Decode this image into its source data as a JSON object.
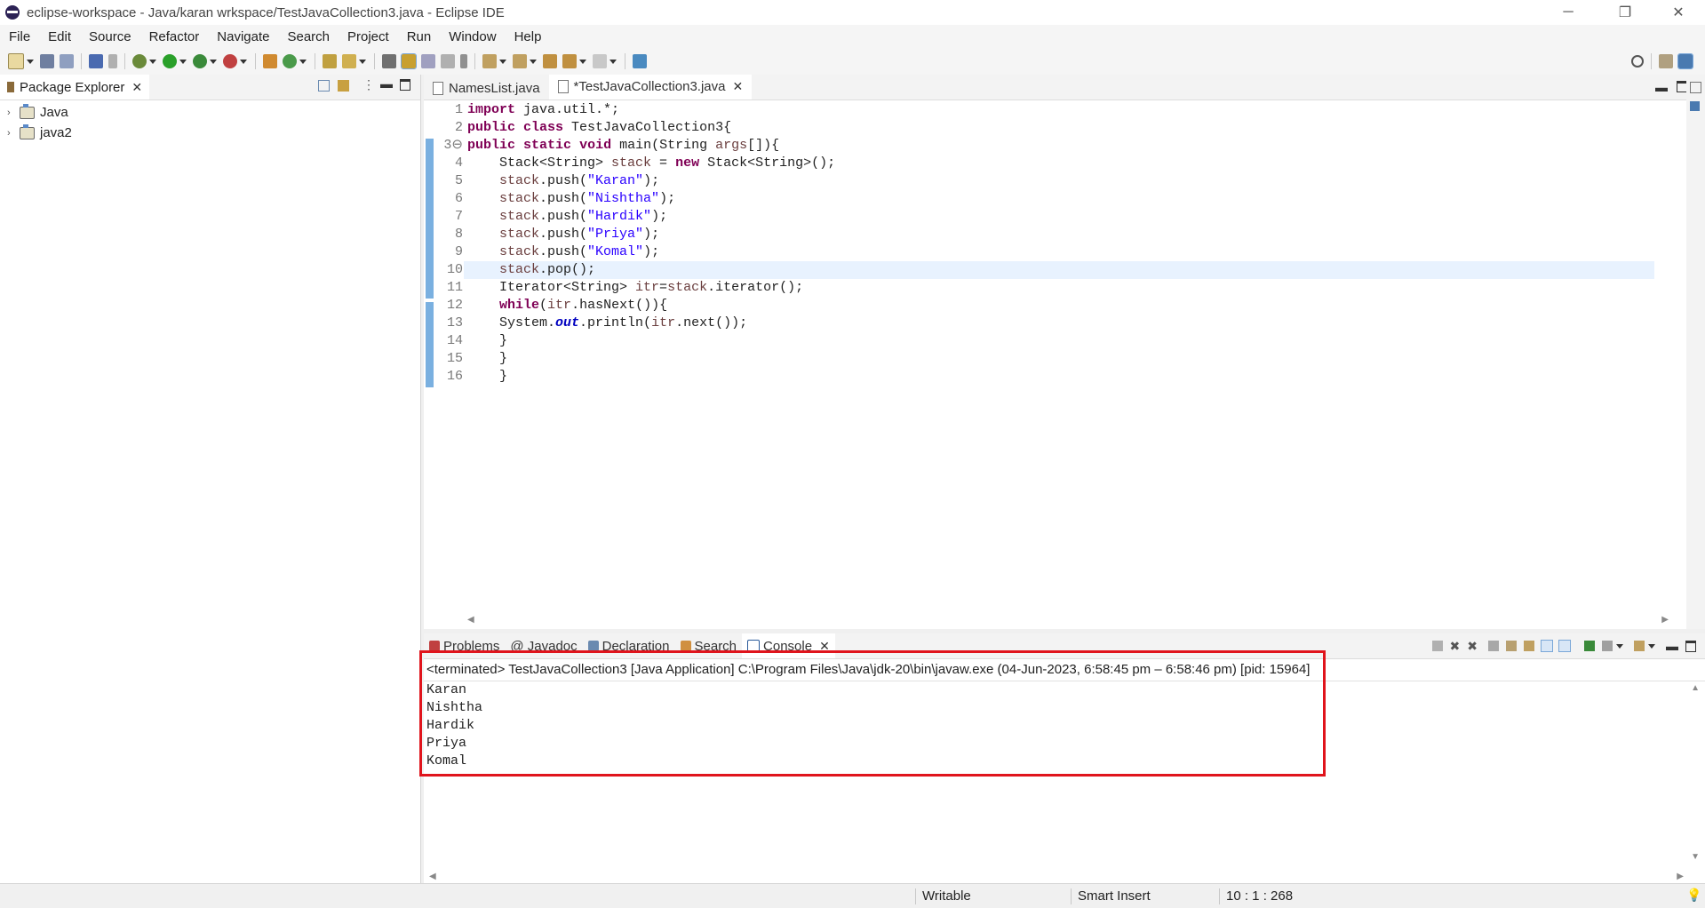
{
  "window": {
    "title": "eclipse-workspace - Java/karan wrkspace/TestJavaCollection3.java - Eclipse IDE",
    "controls": [
      "─",
      "❐",
      "✕"
    ]
  },
  "menu": [
    "File",
    "Edit",
    "Source",
    "Refactor",
    "Navigate",
    "Search",
    "Project",
    "Run",
    "Window",
    "Help"
  ],
  "package_explorer": {
    "title": "Package Explorer",
    "projects": [
      "Java",
      "java2"
    ]
  },
  "editor": {
    "tabs": [
      {
        "label": "NamesList.java",
        "active": false
      },
      {
        "label": "*TestJavaCollection3.java",
        "active": true
      }
    ],
    "line_numbers": [
      "1",
      "2",
      "3⊖",
      "4",
      "5",
      "6",
      "7",
      "8",
      "9",
      "10",
      "11",
      "12",
      "13",
      "14",
      "15",
      "16"
    ],
    "current_line": 10
  },
  "console": {
    "tabs": [
      "Problems",
      "@ Javadoc",
      "Declaration",
      "Search",
      "Console"
    ],
    "header": "<terminated> TestJavaCollection3 [Java Application] C:\\Program Files\\Java\\jdk-20\\bin\\javaw.exe  (04-Jun-2023, 6:58:45 pm – 6:58:46 pm) [pid: 15964]",
    "output": [
      "Karan",
      "Nishtha",
      "Hardik",
      "Priya",
      "Komal"
    ]
  },
  "status": {
    "writable": "Writable",
    "insert_mode": "Smart Insert",
    "position": "10 : 1 : 268"
  },
  "colors": {
    "keyword": "#7f0055",
    "string": "#2a00ff",
    "highlight_box": "#e0141c"
  }
}
